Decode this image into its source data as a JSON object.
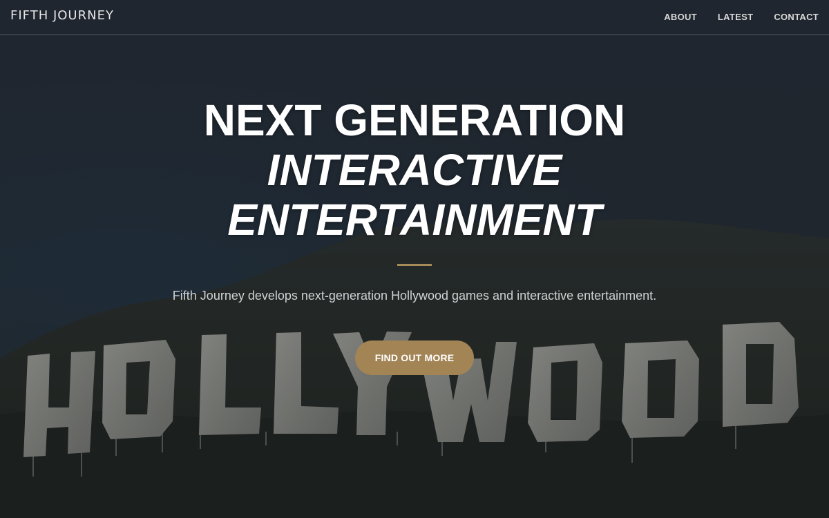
{
  "navbar": {
    "brand": "FIFTH JOURNEY",
    "links": [
      "ABOUT",
      "LATEST",
      "CONTACT"
    ]
  },
  "hero": {
    "headline_line1": "NEXT GENERATION",
    "headline_line2": "INTERACTIVE",
    "headline_line3": "ENTERTAINMENT",
    "subtitle": "Fifth Journey develops next-generation Hollywood games and interactive entertainment.",
    "cta_label": "FIND OUT MORE",
    "sign_text": "HOLLYWOOD"
  },
  "colors": {
    "accent": "#a38455",
    "divider": "#a78a5a",
    "background": "#232a32"
  }
}
